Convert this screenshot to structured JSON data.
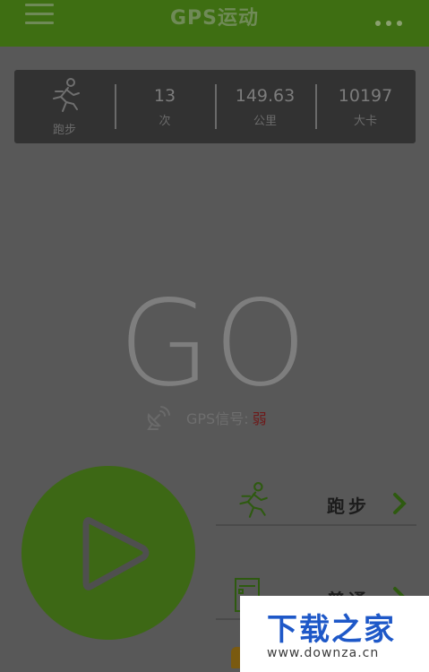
{
  "header": {
    "title": "GPS运动"
  },
  "stats": {
    "mode_label": "跑步",
    "times_value": "13",
    "times_unit": "次",
    "distance_value": "149.63",
    "distance_unit": "公里",
    "calories_value": "10197",
    "calories_unit": "大卡"
  },
  "main": {
    "go_text": "GO",
    "gps_label": "GPS信号:",
    "gps_strength": "弱"
  },
  "modes": [
    {
      "label": "跑步",
      "icon": "runner-icon"
    },
    {
      "label": "普通",
      "icon": "document-icon"
    }
  ],
  "watermark": {
    "title": "下载之家",
    "url": "www.downza.cn"
  },
  "colors": {
    "header_bg": "#3e6e12",
    "start_button": "#3d6815",
    "accent_green": "#2e5a10",
    "weak_signal": "#6e1a1a",
    "watermark_blue": "#1e58c8"
  }
}
